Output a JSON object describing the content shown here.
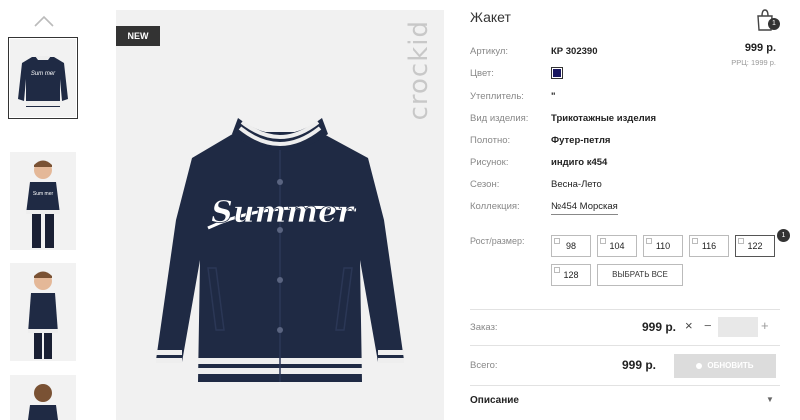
{
  "product": {
    "badge": "NEW",
    "brand": "crockid",
    "title": "Жакет",
    "cart_count": "1"
  },
  "details": [
    {
      "label": "Артикул:",
      "value": "КР 302390"
    },
    {
      "label": "Цвет:",
      "value": ""
    },
    {
      "label": "Утеплитель:",
      "value": "\""
    },
    {
      "label": "Вид изделия:",
      "value": "Трикотажные изделия"
    },
    {
      "label": "Полотно:",
      "value": "Футер-петля"
    },
    {
      "label": "Рисунок:",
      "value": "индиго к454"
    },
    {
      "label": "Сезон:",
      "value": "Весна-Лето"
    },
    {
      "label": "Коллекция:",
      "value": "№454 Морская"
    }
  ],
  "colors": {
    "swatch": "#1a1760",
    "dark": "#333333"
  },
  "pricing": {
    "price": "999 р.",
    "rrp": "РРЦ: 1999 р."
  },
  "sizes": {
    "label": "Рост/размер:",
    "options": [
      "98",
      "104",
      "110",
      "116",
      "122",
      "128"
    ],
    "selected": "122",
    "selected_count": "1",
    "select_all": "ВЫБРАТЬ ВСЕ"
  },
  "order": {
    "label": "Заказ:",
    "price": "999 р.",
    "remove": "×",
    "minus": "−",
    "plus": "+",
    "quantity": ""
  },
  "total": {
    "label": "Всего:",
    "price": "999 р.",
    "button": "ОБНОВИТЬ"
  },
  "description": {
    "label": "Описание",
    "chevron": "▼"
  },
  "icons": [
    "chevron-up-icon",
    "shopping-bag-icon",
    "checkbox-icon",
    "chevron-down-icon"
  ]
}
